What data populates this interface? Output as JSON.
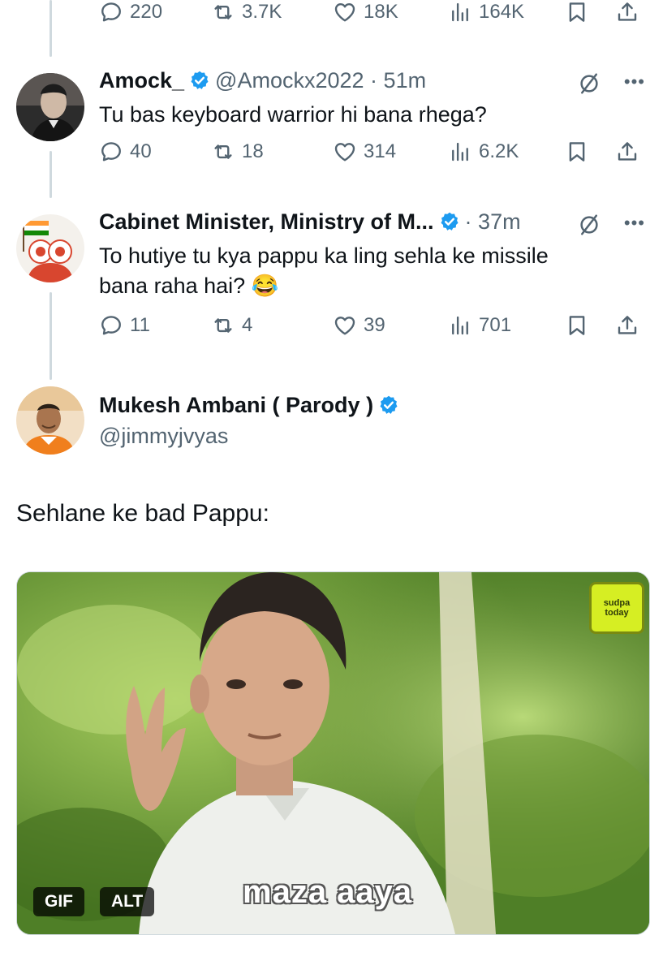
{
  "top_actions": {
    "replies": "220",
    "reposts": "3.7K",
    "likes": "18K",
    "views": "164K"
  },
  "tweets": [
    {
      "name": "Amock_",
      "handle": "@Amockx2022",
      "time": "51m",
      "text": "Tu bas keyboard warrior hi bana rhega?",
      "replies": "40",
      "reposts": "18",
      "likes": "314",
      "views": "6.2K"
    },
    {
      "name": "Cabinet Minister, Ministry of M...",
      "time": "37m",
      "text_line1": "To hutiye tu kya pappu ka ling sehla ke missile",
      "text_line2": "bana raha hai? 😂",
      "replies": "11",
      "reposts": "4",
      "likes": "39",
      "views": "701"
    }
  ],
  "main_tweet": {
    "name": "Mukesh Ambani ( Parody )",
    "handle": "@jimmyjvyas",
    "text": "Sehlane ke bad Pappu:",
    "media": {
      "caption": "maza aaya",
      "badge_gif": "GIF",
      "badge_alt": "ALT",
      "watermark_line1": "sudpa",
      "watermark_line2": "today"
    }
  },
  "colors": {
    "accent": "#1d9bf0",
    "muted": "#536471",
    "thread_line": "#cfd9de"
  }
}
